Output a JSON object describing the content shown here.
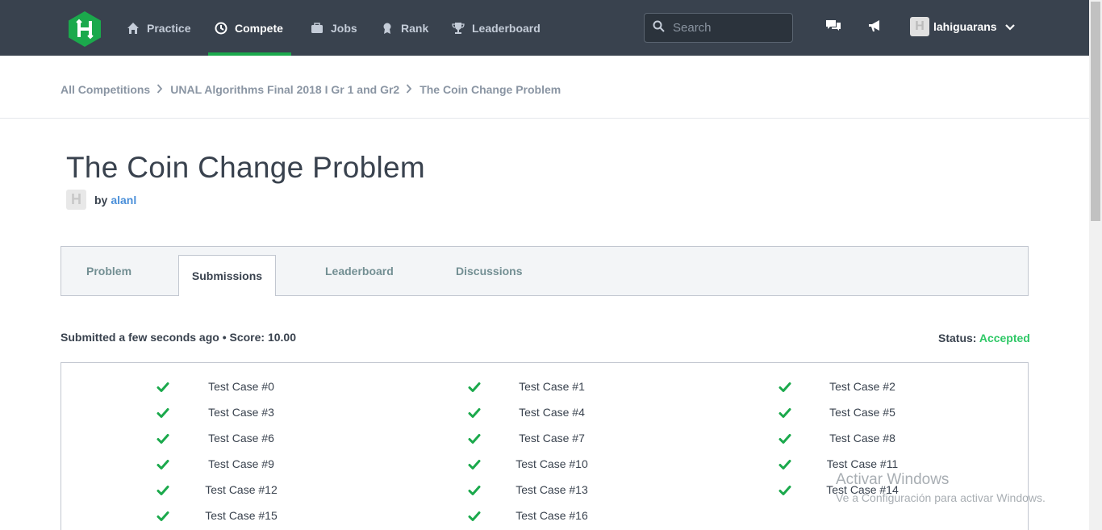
{
  "nav": {
    "items": [
      {
        "label": "Practice",
        "icon": "home-icon"
      },
      {
        "label": "Compete",
        "icon": "clock-icon",
        "active": true
      },
      {
        "label": "Jobs",
        "icon": "briefcase-icon"
      },
      {
        "label": "Rank",
        "icon": "ribbon-icon"
      },
      {
        "label": "Leaderboard",
        "icon": "trophy-icon"
      }
    ],
    "search_placeholder": "Search",
    "username": "lahiguarans",
    "logo_letter": "H"
  },
  "breadcrumb": [
    "All Competitions",
    "UNAL Algorithms Final 2018 I Gr 1 and Gr2",
    "The Coin Change Problem"
  ],
  "problem": {
    "title": "The Coin Change Problem",
    "by": "by",
    "author": "alanl"
  },
  "tabs": [
    "Problem",
    "Submissions",
    "Leaderboard",
    "Discussions"
  ],
  "active_tab": "Submissions",
  "submission": {
    "summary": "Submitted a few seconds ago • Score: 10.00",
    "status_label": "Status:",
    "status_value": "Accepted"
  },
  "test_cases": [
    "Test Case #0",
    "Test Case #1",
    "Test Case #2",
    "Test Case #3",
    "Test Case #4",
    "Test Case #5",
    "Test Case #6",
    "Test Case #7",
    "Test Case #8",
    "Test Case #9",
    "Test Case #10",
    "Test Case #11",
    "Test Case #12",
    "Test Case #13",
    "Test Case #14",
    "Test Case #15",
    "Test Case #16"
  ],
  "watermark": {
    "title": "Activar Windows",
    "subtitle": "Ve a Configuración para activar Windows."
  },
  "colors": {
    "nav_bg": "#39424e",
    "accent_green": "#1ba94c",
    "accepted": "#2ec866",
    "link": "#4a8fd9"
  }
}
